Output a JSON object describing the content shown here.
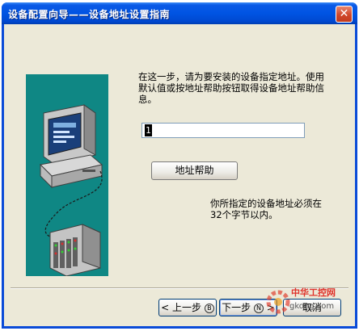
{
  "window": {
    "title": "设备配置向导——设备地址设置指南",
    "close_glyph": "✕"
  },
  "content": {
    "instruction": "在这一步，请为要安装的设备指定地址。使用默认值或按地址帮助按钮取得设备地址帮助信息。",
    "address_value": "1",
    "help_button_label": "地址帮助",
    "note": "你所指定的设备地址必须在32个字节以内。"
  },
  "footer": {
    "back_label": "< 上一步",
    "back_hotkey": "B",
    "next_label": "下一步",
    "next_hotkey": "N",
    "next_suffix": ">",
    "cancel_label": "取消"
  },
  "watermark": {
    "brand": "中华工控网",
    "url": "gkong.com"
  },
  "icons": [
    "computer-illustration",
    "device-rack-illustration",
    "close-icon",
    "watermark-gear-icon"
  ]
}
